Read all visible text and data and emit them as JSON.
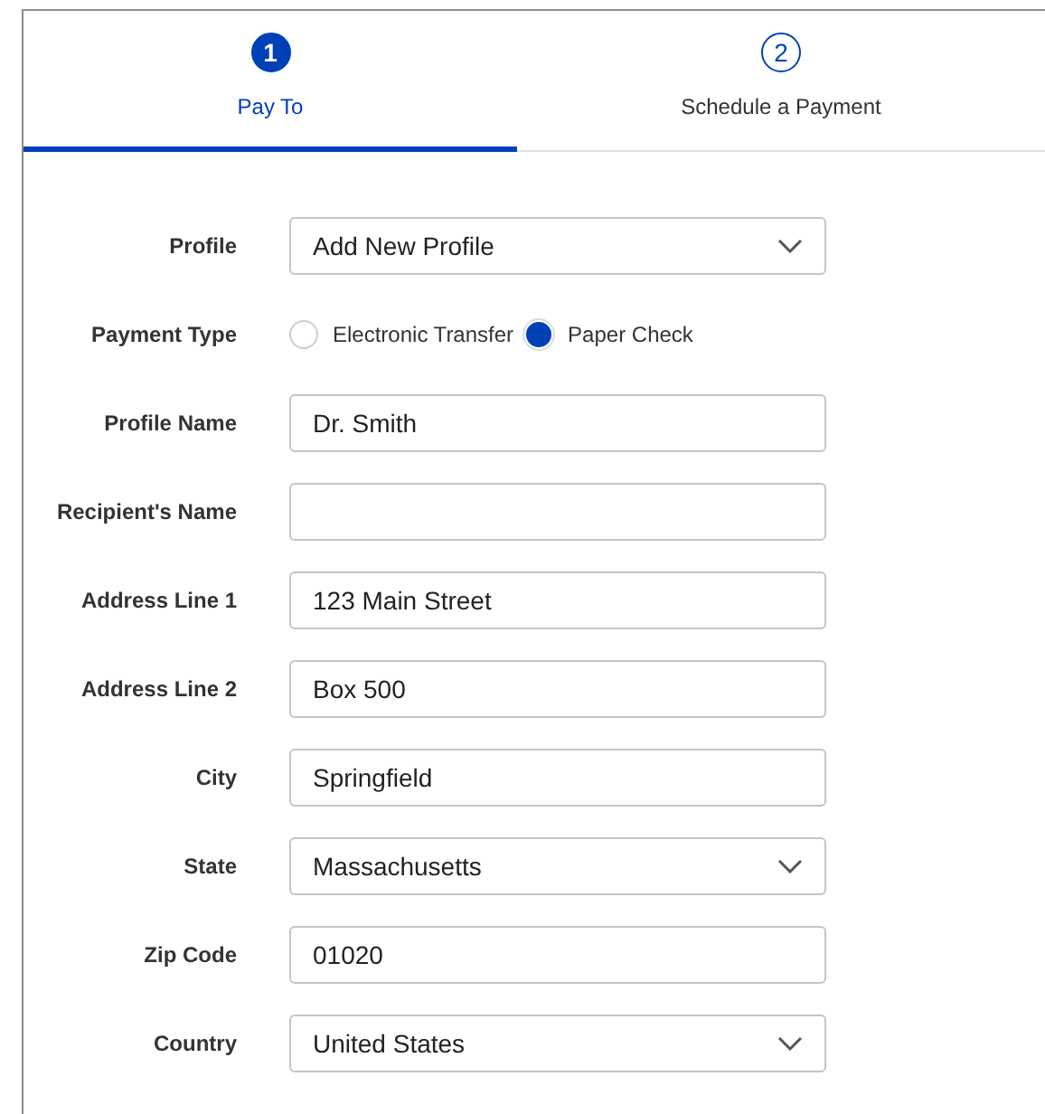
{
  "steps": [
    {
      "number": "1",
      "label": "Pay To",
      "selected": true
    },
    {
      "number": "2",
      "label": "Schedule a Payment",
      "selected": false
    }
  ],
  "fields": [
    {
      "kind": "select",
      "label": "Profile",
      "value": "Add New Profile"
    },
    {
      "kind": "radio",
      "label": "Payment Type",
      "options": [
        {
          "label": "Electronic Transfer",
          "selected": false
        },
        {
          "label": "Paper Check",
          "selected": true
        }
      ]
    },
    {
      "kind": "text",
      "label": "Profile Name",
      "value": "Dr. Smith"
    },
    {
      "kind": "text",
      "label": "Recipient's Name"
    },
    {
      "kind": "text",
      "label": "Address Line 1",
      "value": "123 Main Street"
    },
    {
      "kind": "text",
      "label": "Address Line 2",
      "value": "Box 500"
    },
    {
      "kind": "text",
      "label": "City",
      "value": "Springfield"
    },
    {
      "kind": "select",
      "label": "State",
      "value": "Massachusetts"
    },
    {
      "kind": "text",
      "label": "Zip Code",
      "value": "01020"
    },
    {
      "kind": "select",
      "label": "Country",
      "value": "United States"
    }
  ]
}
